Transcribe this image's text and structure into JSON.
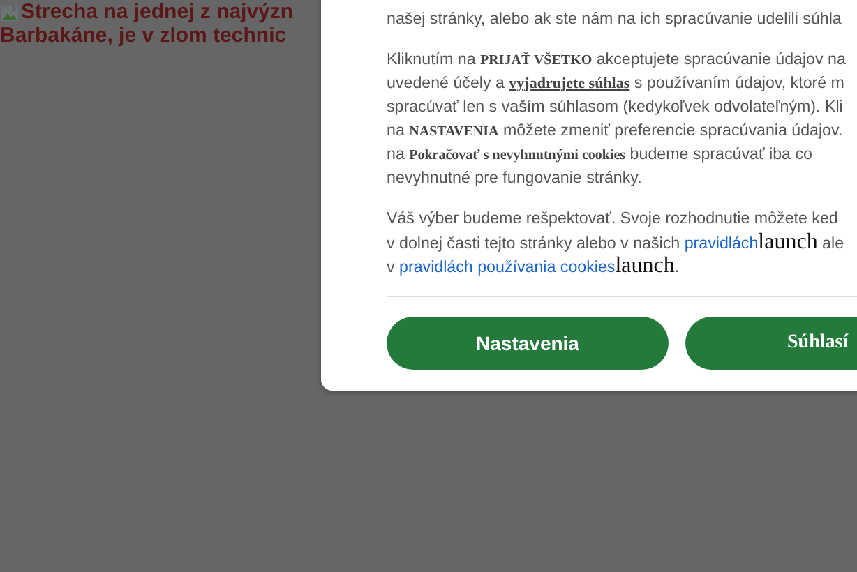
{
  "background": {
    "headline_lines": [
      "Strecha na jednej z najvýzn",
      "Barbakáne, je v zlom technic"
    ]
  },
  "dialog": {
    "paragraphs": [
      [
        [
          {
            "kind": "text",
            "text": "našej stránky, alebo ak ste nám na ich spracúvanie udelili súhla"
          }
        ]
      ],
      [
        [
          {
            "kind": "text",
            "text": "Kliknutím na **PRIJAŤ VŠETKO** akceptujete spracúvanie údajov na"
          }
        ],
        [
          {
            "kind": "text",
            "text": "uvedené účely a "
          },
          {
            "kind": "underlined",
            "text": "vyjadrujete súhlas"
          },
          {
            "kind": "text",
            "text": " s používaním údajov, ktoré m"
          }
        ],
        [
          {
            "kind": "text",
            "text": "spracúvať len s vaším súhlasom (kedykoľvek odvolateľným). Kli"
          }
        ],
        [
          {
            "kind": "text",
            "text": "na **NASTAVENIA** môžete zmeniť preferencie spracúvania údajov."
          }
        ],
        [
          {
            "kind": "text",
            "text": "na **Pokračovať s nevyhnutnými cookies** budeme spracúvať iba co"
          }
        ],
        [
          {
            "kind": "text",
            "text": "nevyhnutné pre fungovanie stránky."
          }
        ]
      ],
      [
        [
          {
            "kind": "text",
            "text": "Váš výber budeme rešpektovať. Svoje rozhodnutie môžete ked"
          }
        ],
        [
          {
            "kind": "text",
            "text": "v dolnej časti tejto stránky alebo v našich "
          },
          {
            "kind": "link",
            "text": "pravidlách"
          },
          {
            "kind": "glyph",
            "text": "launch"
          },
          {
            "kind": "text",
            "text": " ale"
          }
        ],
        [
          {
            "kind": "text",
            "text": "v "
          },
          {
            "kind": "link",
            "text": "pravidlách používania cookies"
          },
          {
            "kind": "glyph",
            "text": "launch"
          },
          {
            "kind": "text",
            "text": "."
          }
        ]
      ]
    ],
    "buttons": [
      {
        "label": "Nastavenia",
        "kind": "sans"
      },
      {
        "label": "Súhlasí",
        "kind": "serif"
      }
    ]
  }
}
